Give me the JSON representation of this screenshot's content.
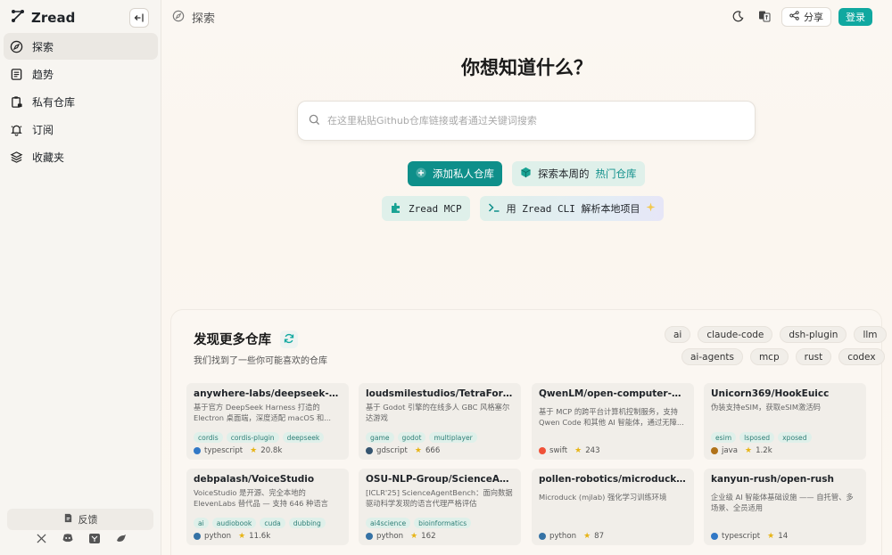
{
  "brand": {
    "name": "Zread"
  },
  "nav": [
    {
      "label": "探索",
      "icon": "compass-icon"
    },
    {
      "label": "趋势",
      "icon": "newspaper-icon"
    },
    {
      "label": "私有仓库",
      "icon": "clipboard-lock-icon"
    },
    {
      "label": "订阅",
      "icon": "bell-icon"
    },
    {
      "label": "收藏夹",
      "icon": "layers-icon"
    }
  ],
  "sidebar_footer": {
    "feedback": "反馈",
    "social": [
      "x-icon",
      "discord-icon",
      "hacker-news-icon",
      "bird-icon"
    ]
  },
  "header": {
    "title": "探索",
    "share": "分享",
    "login": "登录"
  },
  "hero": {
    "title": "你想知道什么？",
    "search_placeholder": "在这里粘贴Github仓库链接或者通过关键词搜索",
    "add_private": "添加私人仓库",
    "explore_prefix": "探索本周的",
    "explore_accent": "热门仓库",
    "mcp": "Zread MCP",
    "cli": "用 Zread CLI 解析本地项目"
  },
  "discover": {
    "title": "发现更多仓库",
    "subtitle": "我们找到了一些你可能喜欢的仓库",
    "tags_row1": [
      "ai",
      "claude-code",
      "dsh-plugin",
      "llm"
    ],
    "tags_row2": [
      "ai-agents",
      "mcp",
      "rust",
      "codex"
    ]
  },
  "repos": [
    {
      "name": "anywhere-labs/deepseek-harness",
      "desc": "基于官方 DeepSeek Harness 打造的 Electron 桌面端，深度适配 macOS 和...",
      "tags": [
        "cordis",
        "cordis-plugin",
        "deepseek"
      ],
      "lang": "typescript",
      "lang_color": "#3178c6",
      "stars": "20.8k"
    },
    {
      "name": "loudsmilestudios/TetraForce",
      "desc": "基于 Godot 引擎的在线多人 GBC 风格塞尔达游戏",
      "tags": [
        "game",
        "godot",
        "multiplayer"
      ],
      "lang": "gdscript",
      "lang_color": "#355570",
      "stars": "666"
    },
    {
      "name": "QwenLM/open-computer-use",
      "desc": "基于 MCP 的跨平台计算机控制服务，支持 Qwen Code 和其他 AI 智能体，通过无障...",
      "tags": [],
      "lang": "swift",
      "lang_color": "#f05138",
      "stars": "243"
    },
    {
      "name": "Unicorn369/HookEuicc",
      "desc": "伪装支持eSIM，获取eSIM激活码",
      "tags": [
        "esim",
        "lsposed",
        "xposed"
      ],
      "lang": "java",
      "lang_color": "#b07219",
      "stars": "1.2k"
    },
    {
      "name": "debpalash/VoiceStudio",
      "desc": "VoiceStudio 是开源、完全本地的 ElevenLabs 替代品 — 支持 646 种语言的...",
      "tags": [
        "ai",
        "audiobook",
        "cuda",
        "dubbing"
      ],
      "lang": "python",
      "lang_color": "#3572a5",
      "stars": "11.6k"
    },
    {
      "name": "OSU-NLP-Group/ScienceAgentBench",
      "desc": "[ICLR'25] ScienceAgentBench：面向数据驱动科学发现的语言代理严格评估",
      "tags": [
        "ai4science",
        "bioinformatics"
      ],
      "lang": "python",
      "lang_color": "#3572a5",
      "stars": "162"
    },
    {
      "name": "pollen-robotics/microduck_rl",
      "desc": "Microduck (mjlab) 强化学习训练环境",
      "tags": [],
      "lang": "python",
      "lang_color": "#3572a5",
      "stars": "87"
    },
    {
      "name": "kanyun-rush/open-rush",
      "desc": "企业级 AI 智能体基础设施 —— 自托管、多场景、全员适用",
      "tags": [],
      "lang": "typescript",
      "lang_color": "#3178c6",
      "stars": "14"
    }
  ]
}
